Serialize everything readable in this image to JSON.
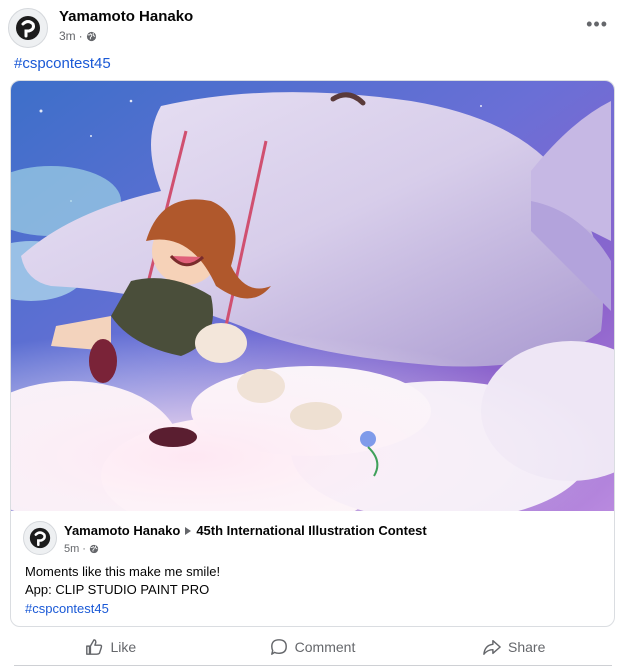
{
  "post": {
    "author": "Yamamoto Hanako",
    "time": "3m",
    "hashtag": "#cspcontest45",
    "more_label": "•••"
  },
  "shared": {
    "author": "Yamamoto Hanako",
    "group": "45th International Illustration Contest",
    "time": "5m",
    "line1": "Moments like this make me smile!",
    "line2": "App: CLIP STUDIO PAINT PRO",
    "hashtag": "#cspcontest45"
  },
  "actions": {
    "like": "Like",
    "comment": "Comment",
    "share": "Share"
  },
  "icons": {
    "globe": "globe-icon",
    "more": "more-options-icon",
    "like": "thumbs-up-icon",
    "comment": "comment-bubble-icon",
    "share": "share-arrow-icon"
  },
  "colors": {
    "link": "#1a59d6",
    "muted": "#65676b",
    "border": "#dadde1"
  }
}
